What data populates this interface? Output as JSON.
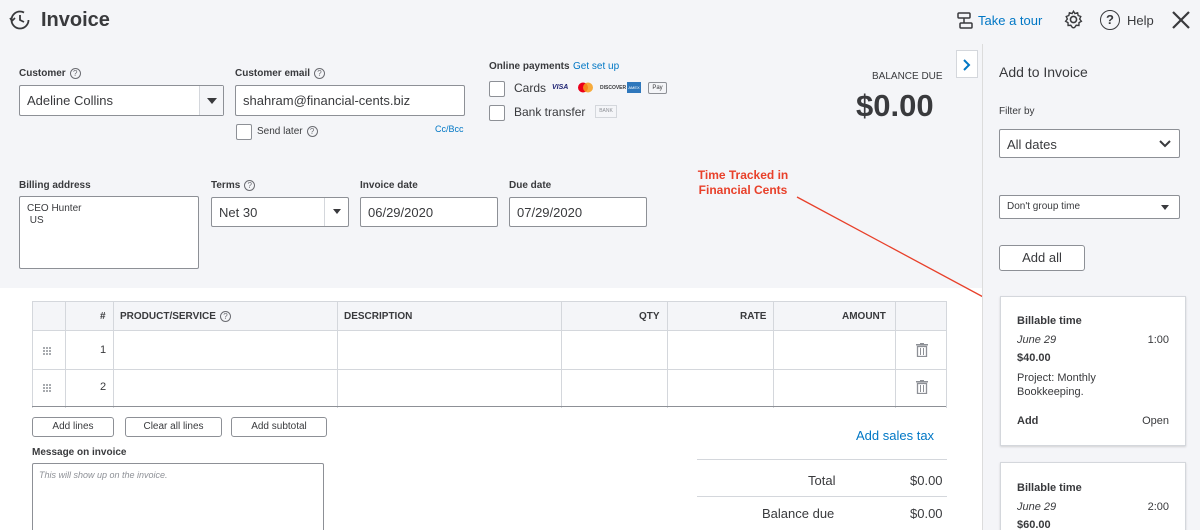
{
  "header": {
    "title": "Invoice",
    "take_tour": "Take a tour",
    "help": "Help"
  },
  "customer": {
    "label": "Customer",
    "value": "Adeline Collins"
  },
  "customer_email": {
    "label": "Customer email",
    "value": "shahram@financial-cents.biz",
    "send_later": "Send later",
    "cc_bcc": "Cc/Bcc"
  },
  "online_payments": {
    "label": "Online payments",
    "setup_link": "Get set up",
    "cards": "Cards",
    "bank_transfer": "Bank transfer",
    "card_logos": [
      "VISA",
      "MC",
      "DISCOVER",
      "AMEX",
      "Pay"
    ],
    "bank_badge": "BANK"
  },
  "balance": {
    "label": "BALANCE DUE",
    "amount": "$0.00"
  },
  "billing": {
    "label": "Billing address",
    "line1": "CEO Hunter",
    "line2": " US"
  },
  "terms": {
    "label": "Terms",
    "value": "Net 30"
  },
  "invoice_date": {
    "label": "Invoice date",
    "value": "06/29/2020"
  },
  "due_date": {
    "label": "Due date",
    "value": "07/29/2020"
  },
  "annotation": {
    "line1": "Time Tracked in",
    "line2": "Financial Cents",
    "color": "#e8402a"
  },
  "table": {
    "headers": {
      "num": "#",
      "product": "PRODUCT/SERVICE",
      "description": "DESCRIPTION",
      "qty": "QTY",
      "rate": "RATE",
      "amount": "AMOUNT"
    },
    "rows": [
      {
        "num": "1"
      },
      {
        "num": "2"
      }
    ]
  },
  "actions": {
    "add_lines": "Add lines",
    "clear_all": "Clear all lines",
    "add_subtotal": "Add subtotal",
    "add_sales_tax": "Add sales tax"
  },
  "message": {
    "label": "Message on invoice",
    "placeholder": "This will show up on the invoice."
  },
  "totals": {
    "total_label": "Total",
    "total_value": "$0.00",
    "balance_label": "Balance due",
    "balance_value": "$0.00"
  },
  "panel": {
    "title": "Add to Invoice",
    "filter_label": "Filter by",
    "filter_value": "All dates",
    "group_value": "Don't group time",
    "add_all": "Add all",
    "cards": [
      {
        "title": "Billable time",
        "date": "June 29",
        "duration": "1:00",
        "amount": "$40.00",
        "project_line1": "Project: Monthly",
        "project_line2": "Bookkeeping.",
        "add": "Add",
        "open": "Open"
      },
      {
        "title": "Billable time",
        "date": "June 29",
        "duration": "2:00",
        "amount": "$60.00"
      }
    ]
  },
  "colors": {
    "accent": "#0077c5",
    "annotation": "#e8402a",
    "form_bg": "#f4f5f8"
  }
}
